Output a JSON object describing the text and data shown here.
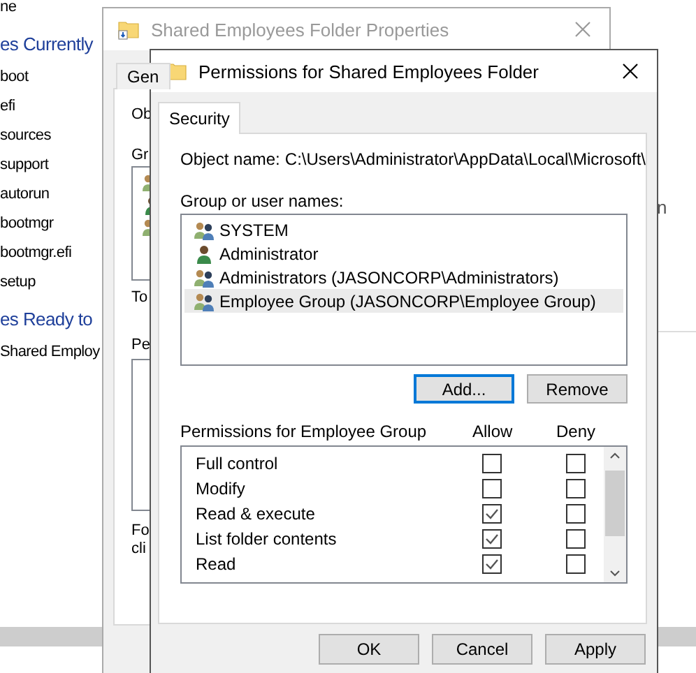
{
  "explorer": {
    "items": [
      {
        "kind": "file",
        "label": "ne"
      },
      {
        "kind": "heading",
        "label": "es Currently"
      },
      {
        "kind": "file",
        "label": "boot"
      },
      {
        "kind": "file",
        "label": "efi"
      },
      {
        "kind": "file",
        "label": "sources"
      },
      {
        "kind": "file",
        "label": "support"
      },
      {
        "kind": "file",
        "label": "autorun"
      },
      {
        "kind": "file",
        "label": "bootmgr"
      },
      {
        "kind": "file",
        "label": "bootmgr.efi"
      },
      {
        "kind": "file",
        "label": "setup"
      },
      {
        "kind": "heading",
        "label": "es Ready to"
      },
      {
        "kind": "file",
        "label": "Shared Employ"
      }
    ],
    "column_3": "n"
  },
  "properties_window": {
    "title": "Shared Employees Folder Properties",
    "tabs": [
      {
        "label": "Gen",
        "selected": false
      }
    ],
    "labels": [
      "Ob",
      "Gr",
      "To",
      "Pe"
    ],
    "note": [
      "Fo",
      "cli"
    ]
  },
  "dialog": {
    "title": "Permissions for Shared Employees Folder",
    "tabs": [
      {
        "label": "Security",
        "selected": true
      }
    ],
    "object_name_label": "Object name:",
    "object_name": "C:\\Users\\Administrator\\AppData\\Local\\Microsoft\\",
    "groups_label": "Group or user names:",
    "groups": [
      {
        "name": "SYSTEM",
        "kind": "group",
        "selected": false
      },
      {
        "name": "Administrator",
        "kind": "user",
        "selected": false
      },
      {
        "name": "Administrators (JASONCORP\\Administrators)",
        "kind": "group",
        "selected": false
      },
      {
        "name": "Employee Group (JASONCORP\\Employee Group)",
        "kind": "group",
        "selected": true
      }
    ],
    "buttons": [
      {
        "label": "Add...",
        "focused": true
      },
      {
        "label": "Remove",
        "focused": false
      }
    ],
    "permissions_label": "Permissions for Employee Group",
    "allow_header": "Allow",
    "deny_header": "Deny",
    "permissions": [
      {
        "name": "Full control",
        "allow": false,
        "deny": false
      },
      {
        "name": "Modify",
        "allow": false,
        "deny": false
      },
      {
        "name": "Read & execute",
        "allow": true,
        "deny": false
      },
      {
        "name": "List folder contents",
        "allow": true,
        "deny": false
      },
      {
        "name": "Read",
        "allow": true,
        "deny": false
      }
    ],
    "footer_buttons": [
      "OK",
      "Cancel",
      "Apply"
    ]
  }
}
